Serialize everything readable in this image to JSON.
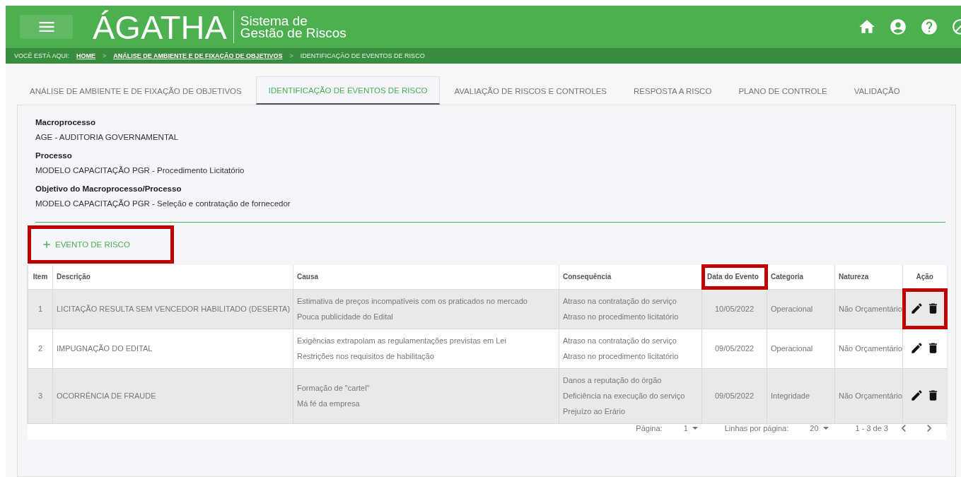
{
  "header": {
    "logo": "ÁGATHA",
    "subtitle": [
      "Sistema de",
      "Gestão de Riscos"
    ]
  },
  "breadcrumb": {
    "label": "VOCÊ ESTÁ AQUI:",
    "separator": ">",
    "items": [
      {
        "text": "HOME",
        "link": true
      },
      {
        "text": "ANÁLISE DE AMBIENTE E DE FIXAÇÃO DE OBJETIVOS",
        "link": true
      },
      {
        "text": "IDENTIFICAÇÃO DE EVENTOS DE RISCO",
        "link": false
      }
    ]
  },
  "tabs": [
    {
      "label": "ANÁLISE DE AMBIENTE E DE FIXAÇÃO DE OBJETIVOS",
      "selected": false
    },
    {
      "label": "IDENTIFICAÇÃO DE EVENTOS DE RISCO",
      "selected": true
    },
    {
      "label": "AVALIAÇÃO DE RISCOS E CONTROLES",
      "selected": false
    },
    {
      "label": "RESPOSTA A RISCO",
      "selected": false
    },
    {
      "label": "PLANO DE CONTROLE",
      "selected": false
    },
    {
      "label": "VALIDAÇÃO",
      "selected": false
    }
  ],
  "fields": [
    {
      "label": "Macroprocesso",
      "value": "AGE - AUDITORIA GOVERNAMENTAL"
    },
    {
      "label": "Processo",
      "value": "MODELO CAPACITAÇÃO PGR - Procedimento Licitatório"
    },
    {
      "label": "Objetivo do Macroprocesso/Processo",
      "value": "MODELO CAPACITAÇÃO PGR - Seleção e contratação de fornecedor"
    }
  ],
  "add_button": {
    "label": "EVENTO DE RISCO",
    "highlighted": true
  },
  "table": {
    "columns": [
      {
        "label": "Item",
        "highlighted": false
      },
      {
        "label": "Descrição",
        "highlighted": false
      },
      {
        "label": "Causa",
        "highlighted": false
      },
      {
        "label": "Consequência",
        "highlighted": false
      },
      {
        "label": "Data do Evento",
        "highlighted": true
      },
      {
        "label": "Categoria",
        "highlighted": false
      },
      {
        "label": "Natureza",
        "highlighted": false
      },
      {
        "label": "Ação",
        "highlighted": false
      }
    ],
    "rows": [
      {
        "item": "1",
        "description": "LICITAÇÃO RESULTA SEM VENCEDOR HABILITADO (DESERTA)",
        "causes": [
          "Estimativa de preços incompatíveis com os praticados no mercado",
          "Pouca publicidade do Edital"
        ],
        "consequences": [
          "Atraso na contratação do serviço",
          "Atraso no procedimento licitatório"
        ],
        "date": "10/05/2022",
        "category": "Operacional",
        "nature": "Não Orçamentário",
        "actions_highlighted": true
      },
      {
        "item": "2",
        "description": "IMPUGNAÇÃO DO EDITAL",
        "causes": [
          "Exigências extrapolam as regulamentações previstas em Lei",
          "Restrições nos requisitos de habilitação"
        ],
        "consequences": [
          "Atraso na contratação do serviço",
          "Atraso no procedimento licitatório"
        ],
        "date": "09/05/2022",
        "category": "Operacional",
        "nature": "Não Orçamentário",
        "actions_highlighted": false
      },
      {
        "item": "3",
        "description": "OCORRÊNCIA DE FRAUDE",
        "causes": [
          "Formação de \"cartel\"",
          "Má fé da empresa"
        ],
        "consequences": [
          "Danos a reputação do órgão",
          "Deficiência na execução do serviço",
          "Prejuízo ao Erário"
        ],
        "date": "09/05/2022",
        "category": "Integridade",
        "nature": "Não Orçamentário",
        "actions_highlighted": false
      }
    ]
  },
  "pagination": {
    "page_label": "Página:",
    "page": "1",
    "rows_label": "Linhas por página:",
    "rows": "20",
    "range": "1 - 3 de 3"
  }
}
